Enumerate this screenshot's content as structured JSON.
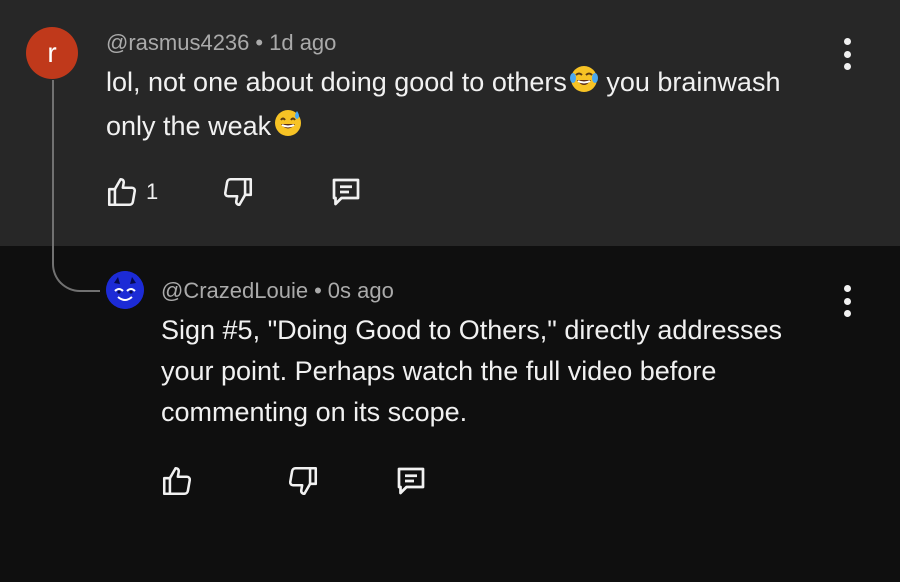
{
  "comments": [
    {
      "avatar_letter": "r",
      "avatar_color": "#c0391b",
      "author": "@rasmus4236",
      "separator": "•",
      "time": "1d ago",
      "text_part1": "lol, not one about doing good to others",
      "text_part2": " you brainwash",
      "text_part3": "only the weak",
      "emoji1": "face-with-tears-of-joy",
      "emoji2": "grinning-sweat-face",
      "like_count": "1"
    },
    {
      "avatar_color": "#1c2bd6",
      "author": "@CrazedLouie",
      "separator": "•",
      "time": "0s ago",
      "text_line1": "Sign #5, \"Doing Good to Others,\" directly addresses",
      "text_line2": "your point. Perhaps watch the full video before",
      "text_line3": "commenting on its scope.",
      "like_count": ""
    }
  ],
  "colors": {
    "top_background": "#272727",
    "bottom_background": "#0f0f0f",
    "meta_text": "#aaaaaa",
    "body_text": "#f1f1f1"
  }
}
